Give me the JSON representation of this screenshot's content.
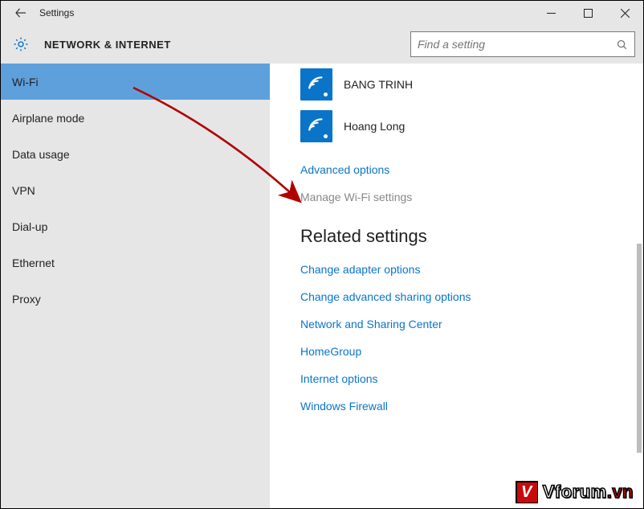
{
  "window": {
    "title": "Settings"
  },
  "header": {
    "section_title": "NETWORK & INTERNET",
    "search_placeholder": "Find a setting"
  },
  "sidebar": {
    "items": [
      {
        "label": "Wi-Fi",
        "active": true
      },
      {
        "label": "Airplane mode",
        "active": false
      },
      {
        "label": "Data usage",
        "active": false
      },
      {
        "label": "VPN",
        "active": false
      },
      {
        "label": "Dial-up",
        "active": false
      },
      {
        "label": "Ethernet",
        "active": false
      },
      {
        "label": "Proxy",
        "active": false
      }
    ]
  },
  "content": {
    "networks": [
      {
        "name": "BANG TRINH"
      },
      {
        "name": "Hoang Long"
      }
    ],
    "advanced_link": "Advanced options",
    "manage_link": "Manage Wi-Fi settings",
    "related_heading": "Related settings",
    "related_links": [
      "Change adapter options",
      "Change advanced sharing options",
      "Network and Sharing Center",
      "HomeGroup",
      "Internet options",
      "Windows Firewall"
    ]
  },
  "watermark": {
    "badge": "V",
    "text_main": "Vforum",
    "text_suffix": ".vn"
  },
  "colors": {
    "accent": "#0a74c9",
    "sidebar_active": "#5ea0dc"
  }
}
